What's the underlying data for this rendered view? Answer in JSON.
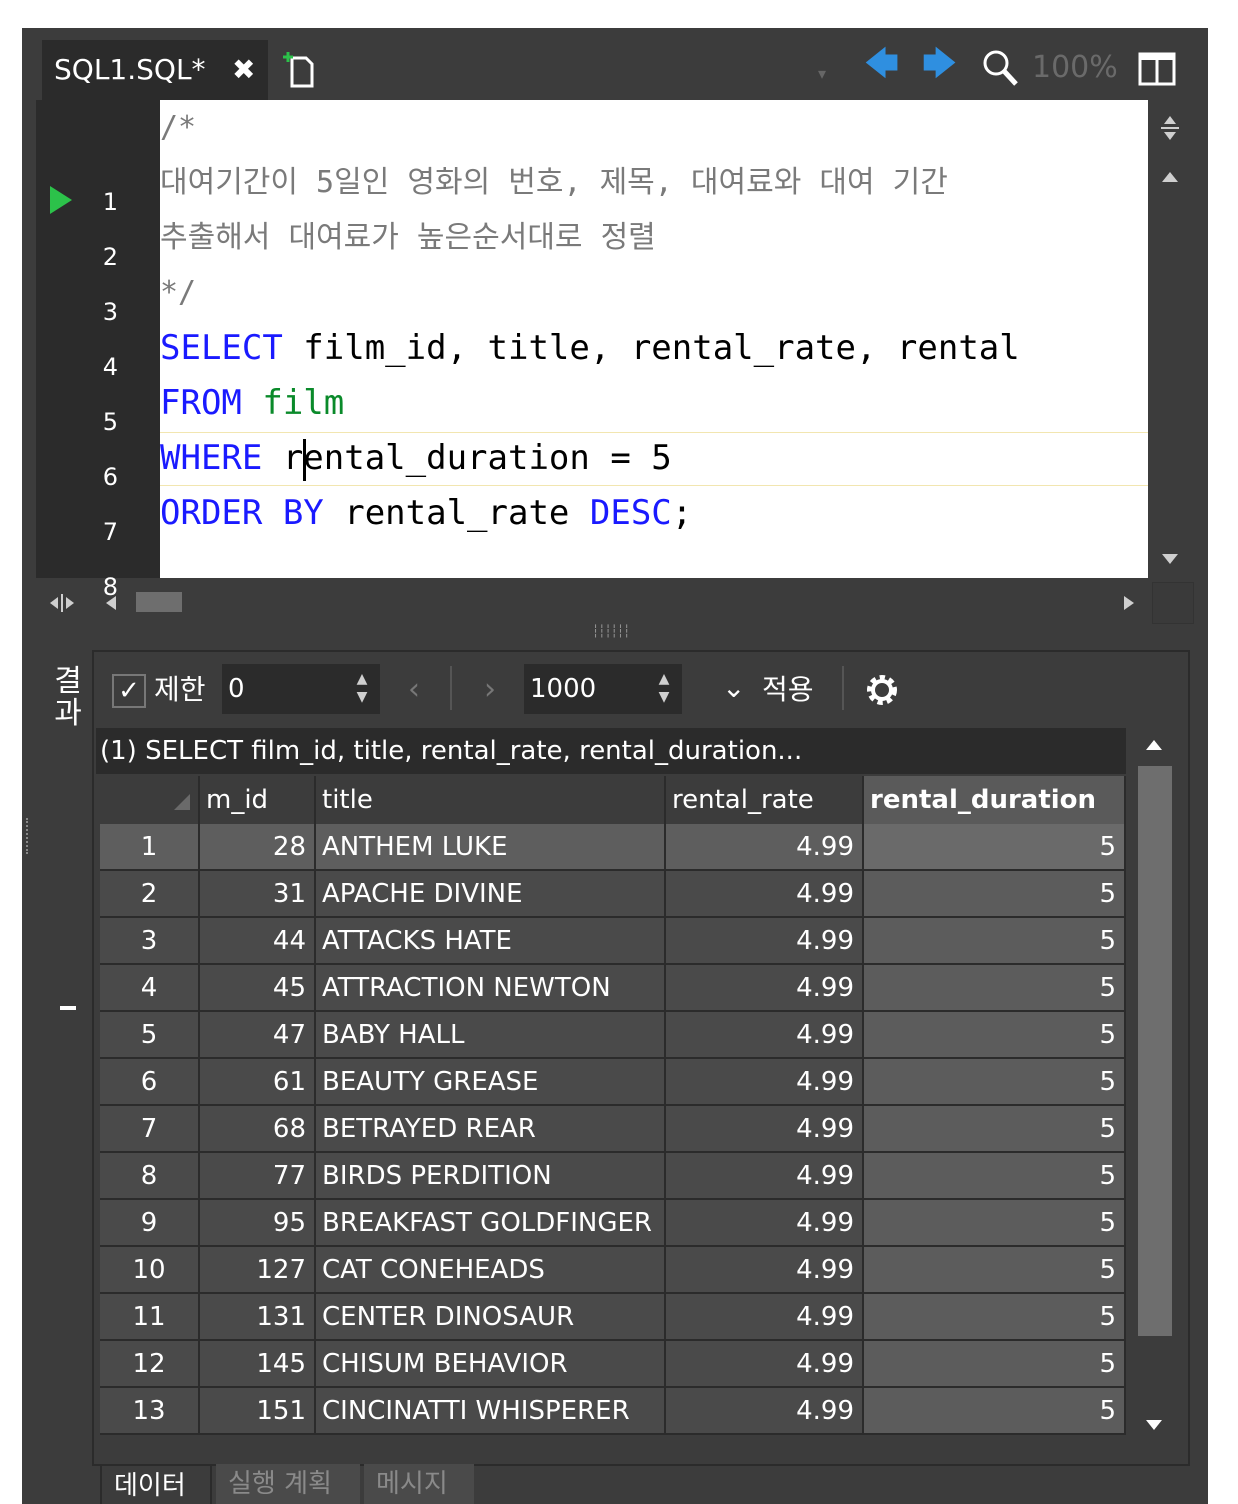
{
  "tab": {
    "title": "SQL1.SQL*",
    "close": "✖"
  },
  "toolbar": {
    "zoom": "100%",
    "dropdown": "▾",
    "back": "🡄",
    "forward": "🡆"
  },
  "gutter": {
    "lines": [
      "1",
      "2",
      "3",
      "4",
      "5",
      "6",
      "7",
      "8"
    ]
  },
  "code": {
    "l1": "/*",
    "l2": "대여기간이 5일인 영화의 번호, 제목, 대여료와 대여 기간",
    "l3": "추출해서 대여료가 높은순서대로 정렬",
    "l4": "*/",
    "l5_kw": "SELECT",
    "l5_rest": " film_id, title, rental_rate, rental",
    "l6_kw": "FROM",
    "l6_tbl": " film",
    "l7_kw": "WHERE",
    "l7_rest": " rental_duration = 5",
    "l8_kw1": "ORDER BY",
    "l8_mid": " rental_rate ",
    "l8_kw2": "DESC",
    "l8_end": ";"
  },
  "result": {
    "side_label": "결과",
    "limit_check": "✓",
    "limit_label": "제한",
    "limit_value": "0",
    "prev": "‹",
    "next": "›",
    "page_size": "1000",
    "apply_caret": "⌄",
    "apply_label": "적용",
    "query_header": "(1) SELECT film_id, title, rental_rate, rental_duration...",
    "columns": [
      "m_id",
      "title",
      "rental_rate",
      "rental_duration"
    ],
    "rows": [
      [
        "1",
        "28",
        "ANTHEM LUKE",
        "4.99",
        "5"
      ],
      [
        "2",
        "31",
        "APACHE DIVINE",
        "4.99",
        "5"
      ],
      [
        "3",
        "44",
        "ATTACKS HATE",
        "4.99",
        "5"
      ],
      [
        "4",
        "45",
        "ATTRACTION NEWTON",
        "4.99",
        "5"
      ],
      [
        "5",
        "47",
        "BABY HALL",
        "4.99",
        "5"
      ],
      [
        "6",
        "61",
        "BEAUTY GREASE",
        "4.99",
        "5"
      ],
      [
        "7",
        "68",
        "BETRAYED REAR",
        "4.99",
        "5"
      ],
      [
        "8",
        "77",
        "BIRDS PERDITION",
        "4.99",
        "5"
      ],
      [
        "9",
        "95",
        "BREAKFAST GOLDFINGER",
        "4.99",
        "5"
      ],
      [
        "10",
        "127",
        "CAT CONEHEADS",
        "4.99",
        "5"
      ],
      [
        "11",
        "131",
        "CENTER DINOSAUR",
        "4.99",
        "5"
      ],
      [
        "12",
        "145",
        "CHISUM BEHAVIOR",
        "4.99",
        "5"
      ],
      [
        "13",
        "151",
        "CINCINATTI WHISPERER",
        "4.99",
        "5"
      ]
    ]
  },
  "bottom_tabs": [
    "데이터",
    "실행 계획",
    "메시지"
  ]
}
